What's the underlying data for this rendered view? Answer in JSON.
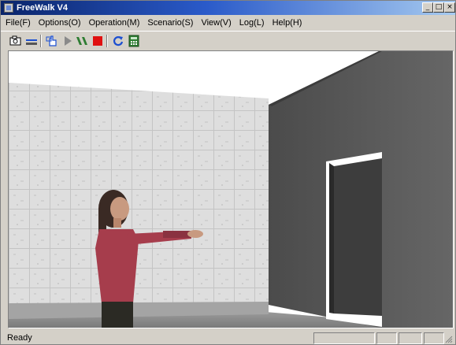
{
  "window": {
    "title": "FreeWalk V4"
  },
  "title_controls": {
    "minimize": "_",
    "maximize": "□",
    "close": "×"
  },
  "menu": [
    {
      "label": "File(F)"
    },
    {
      "label": "Options(O)"
    },
    {
      "label": "Operation(M)"
    },
    {
      "label": "Scenario(S)"
    },
    {
      "label": "View(V)"
    },
    {
      "label": "Log(L)"
    },
    {
      "label": "Help(H)"
    }
  ],
  "toolbar": {
    "buttons": [
      {
        "icon": "camera-icon"
      },
      {
        "icon": "layers-icon"
      },
      {
        "icon": "hand-pointer-icon"
      },
      {
        "icon": "play-icon"
      },
      {
        "icon": "fast-forward-icon"
      },
      {
        "icon": "stop-icon"
      },
      {
        "icon": "refresh-icon"
      },
      {
        "icon": "calculator-icon"
      }
    ]
  },
  "status": {
    "text": "Ready"
  },
  "colors": {
    "titlebar_start": "#0a246a",
    "titlebar_end": "#a6caf0",
    "chrome": "#d4d0c8",
    "stop_red": "#e01010",
    "play_gray": "#8a8a8a",
    "refresh_blue": "#1c4fd1",
    "calculator_green": "#2e7d32"
  }
}
